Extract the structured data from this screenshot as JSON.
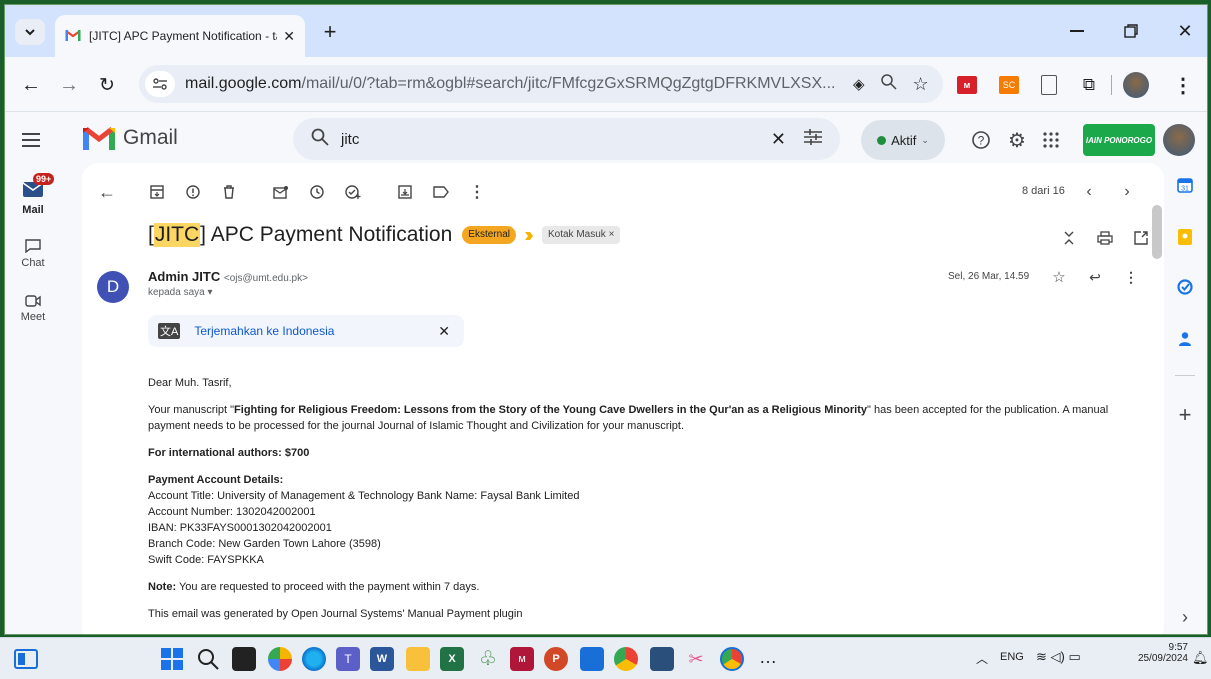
{
  "browser": {
    "tab_title": "[JITC] APC Payment Notification - tasr",
    "url_host": "mail.google.com",
    "url_path": "/mail/u/0/?tab=rm&ogbl#search/jitc/FMfcgzGxSRMQgZgtgDFRKMVLXSX..."
  },
  "gmail": {
    "brand": "Gmail",
    "search_value": "jitc",
    "status": "Aktif",
    "org_badge": "IAIN PONOROGO",
    "mail_badge": "99+",
    "rail": {
      "mail": "Mail",
      "chat": "Chat",
      "meet": "Meet"
    }
  },
  "message": {
    "counter": "8 dari 16",
    "subject_tag": "JITC",
    "subject_rest": " APC Payment Notification",
    "label_external": "Eksternal",
    "label_inbox": "Kotak Masuk",
    "sender_initial": "D",
    "sender_name": "Admin JITC",
    "sender_email": "<ojs@umt.edu.pk>",
    "recipient": "kepada saya",
    "date": "Sel, 26 Mar, 14.59",
    "translate": "Terjemahkan ke Indonesia",
    "body": {
      "greeting": "Dear Muh. Tasrif,",
      "p1_a": "Your manuscript \"",
      "p1_title": "Fighting for Religious Freedom: Lessons from the Story of the Young Cave Dwellers in the Qur'an as a Religious Minority",
      "p1_b": "\" has been accepted for the publication.  A manual payment needs to be processed for the journal Journal of Islamic Thought and Civilization for your manuscript.",
      "intl": "For international authors: $700",
      "details_heading": "Payment Account Details:",
      "details": [
        "Account Title: University of Management & Technology Bank Name: Faysal Bank Limited",
        "Account Number: 1302042002001",
        "IBAN: PK33FAYS0001302042002001",
        "Branch Code: New Garden Town Lahore (3598)",
        "Swift Code: FAYSPKKA"
      ],
      "note_label": "Note:",
      "note_text": " You are requested to proceed with the payment within 7 days.",
      "footer": "This email was generated by Open Journal Systems' Manual Payment plugin"
    }
  },
  "taskbar": {
    "lang": "ENG",
    "time": "9:57",
    "date": "25/09/2024"
  },
  "colors": {
    "accent": "#0b57d0",
    "highlight": "#fcd663",
    "external": "#f4a620",
    "taskbar": "#e8eef4"
  }
}
